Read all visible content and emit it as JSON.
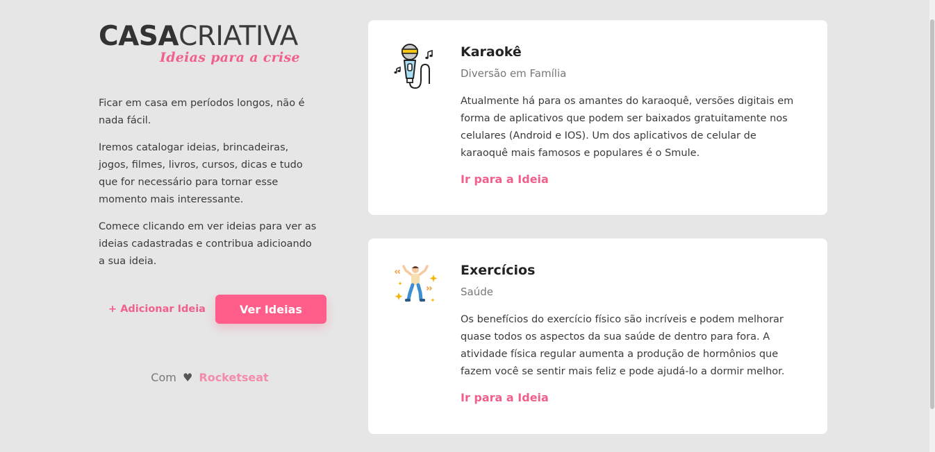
{
  "logo": {
    "part1": "CASA",
    "part2": "CRIATIVA",
    "tagline": "Ideias para a crise"
  },
  "intro": {
    "paragraphs": [
      "Ficar em casa em períodos longos, não é nada fácil.",
      "Iremos catalogar ideias, brincadeiras, jogos, filmes, livros, cursos, dicas e tudo que for necessário para tornar esse momento mais interessante.",
      "Comece clicando em ver ideias para ver as ideias cadastradas e contribua adicioando a sua ideia."
    ]
  },
  "actions": {
    "add_label": "+ Adicionar Ideia",
    "view_label": "Ver Ideias"
  },
  "footer": {
    "prefix": "Com",
    "heart": "♥",
    "brand": "Rocketseat"
  },
  "ideas": [
    {
      "icon": "microphone-icon",
      "title": "Karaokê",
      "category": "Diversão em Família",
      "description": "Atualmente há para os amantes do karaoquê, versões digitais em forma de aplicativos que podem ser baixados gratuitamente nos celulares (Android e IOS). Um dos aplicativos de celular de karaoquê mais famosos e populares é o Smule.",
      "link_label": "Ir para a Ideia"
    },
    {
      "icon": "dancing-person-icon",
      "title": "Exercícios",
      "category": "Saúde",
      "description": "Os benefícios do exercício físico são incríveis e podem melhorar quase todos os aspectos da sua saúde de dentro para fora. A atividade física regular aumenta a produção de hormônios que fazem você se sentir mais feliz e pode ajudá-lo a dormir melhor.",
      "link_label": "Ir para a Ideia"
    }
  ],
  "colors": {
    "accent": "#ff5d8a",
    "link": "#f0608a",
    "background": "#e6e6e6",
    "card": "#ffffff"
  }
}
